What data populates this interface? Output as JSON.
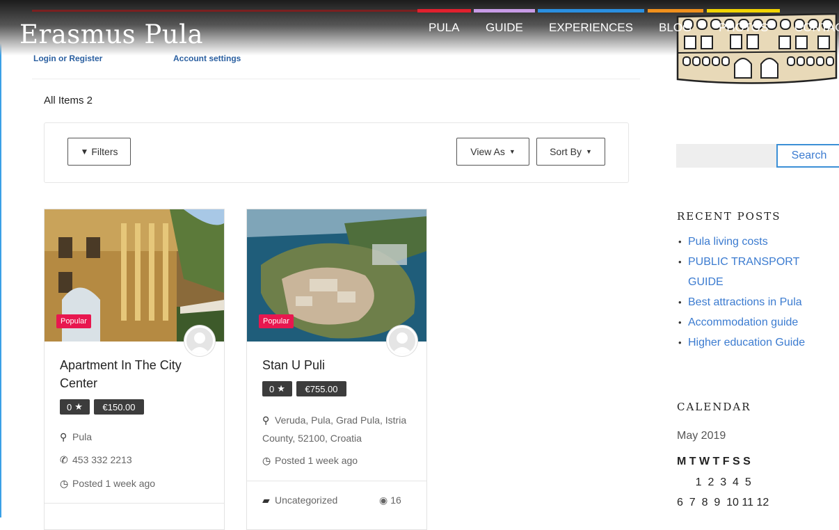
{
  "site": {
    "title": "Erasmus Pula"
  },
  "nav": {
    "items": [
      "PULA",
      "GUIDE",
      "EXPERIENCES",
      "BLOG",
      "PHOTOS",
      "CONTACT"
    ],
    "colors": [
      "#e0202e",
      "#c79be6",
      "#2a8fe0",
      "#f0901c",
      "#f2d400"
    ]
  },
  "user_links": {
    "login": "Login or Register",
    "account": "Account settings"
  },
  "listing": {
    "count_label": "All Items 2",
    "filters_label": "Filters",
    "view_as_label": "View As",
    "sort_by_label": "Sort By"
  },
  "cards": [
    {
      "badge": "Popular",
      "title": "Apartment In The City Center",
      "rating": "0",
      "price": "€150.00",
      "location": "Pula",
      "phone": "453 332 2213",
      "posted": "Posted 1 week ago"
    },
    {
      "badge": "Popular",
      "title": "Stan U Puli",
      "rating": "0",
      "price": "€755.00",
      "location": "Veruda, Pula, Grad Pula, Istria County, 52100, Croatia",
      "posted": "Posted 1 week ago",
      "category": "Uncategorized",
      "views": "16"
    }
  ],
  "sidebar": {
    "search_button": "Search",
    "recent_title": "RECENT POSTS",
    "recent_posts": [
      "Pula living costs",
      "PUBLIC TRANSPORT GUIDE",
      "Best attractions in Pula",
      "Accommodation guide",
      "Higher education Guide"
    ],
    "calendar_title": "CALENDAR",
    "calendar_month": "May 2019",
    "calendar_days_header": "M T W T F S S",
    "calendar_row1": "      1  2  3  4  5",
    "calendar_row2": "6  7  8  9  10 11 12"
  }
}
